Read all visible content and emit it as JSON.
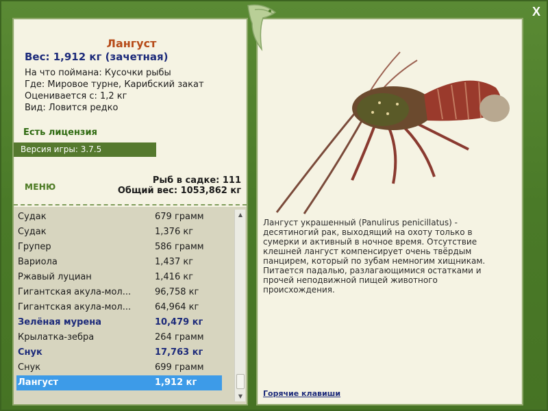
{
  "window": {
    "close_label": "X"
  },
  "fish": {
    "name": "Лангуст",
    "weight_line": "Вес: 1,912 кг (зачетная)",
    "caught_on": "На что поймана: Кусочки рыбы",
    "location": "Где: Мировое турне, Карибский закат",
    "valued_from": "Оценивается с: 1,2 кг",
    "kind": "Вид: Ловится редко",
    "description": "Лангуст украшенный (Panulirus penicillatus) - десятиногий рак, выходящий на охоту только в сумерки и активный в ночное время. Отсутствие клешней лангуст компенсирует очень твёрдым панцирем, который по зубам немногим хищникам. Питается падалью, разлагающимися остатками и прочей неподвижной пищей животного происхождения."
  },
  "license": "Есть лицензия",
  "version": "Версия игры: 3.7.5",
  "menu_label": "МЕНЮ",
  "stats": {
    "fish_in_keepnet": "Рыб в садке: 111",
    "total_weight": "Общий вес: 1053,862 кг"
  },
  "catch_list": [
    {
      "name": "Судак",
      "weight": "679 грамм",
      "bold": false,
      "selected": false
    },
    {
      "name": "Судак",
      "weight": "1,376 кг",
      "bold": false,
      "selected": false
    },
    {
      "name": "Групер",
      "weight": "586 грамм",
      "bold": false,
      "selected": false
    },
    {
      "name": "Вариола",
      "weight": "1,437 кг",
      "bold": false,
      "selected": false
    },
    {
      "name": "Ржавый луциан",
      "weight": "1,416 кг",
      "bold": false,
      "selected": false
    },
    {
      "name": "Гигантская акула-мол...",
      "weight": "96,758 кг",
      "bold": false,
      "selected": false
    },
    {
      "name": "Гигантская акула-мол...",
      "weight": "64,964 кг",
      "bold": false,
      "selected": false
    },
    {
      "name": "Зелёная мурена",
      "weight": "10,479 кг",
      "bold": true,
      "selected": false
    },
    {
      "name": "Крылатка-зебра",
      "weight": "264 грамм",
      "bold": false,
      "selected": false
    },
    {
      "name": "Снук",
      "weight": "17,763 кг",
      "bold": true,
      "selected": false
    },
    {
      "name": "Снук",
      "weight": "699 грамм",
      "bold": false,
      "selected": false
    },
    {
      "name": "Лангуст",
      "weight": "1,912 кг",
      "bold": true,
      "selected": true
    }
  ],
  "hotkeys_label": "Горячие клавиши",
  "colors": {
    "frame_green": "#4f7d2c",
    "panel_bg": "#f5f3e3",
    "title_orange": "#b64a17",
    "weight_blue": "#1c2a7a",
    "selection_blue": "#3d9be8",
    "version_bar": "#55792e"
  },
  "icons": {
    "close": "close-icon",
    "logo": "fish-logo-icon",
    "scroll_up": "scroll-up-arrow-icon",
    "scroll_down": "scroll-down-arrow-icon"
  }
}
